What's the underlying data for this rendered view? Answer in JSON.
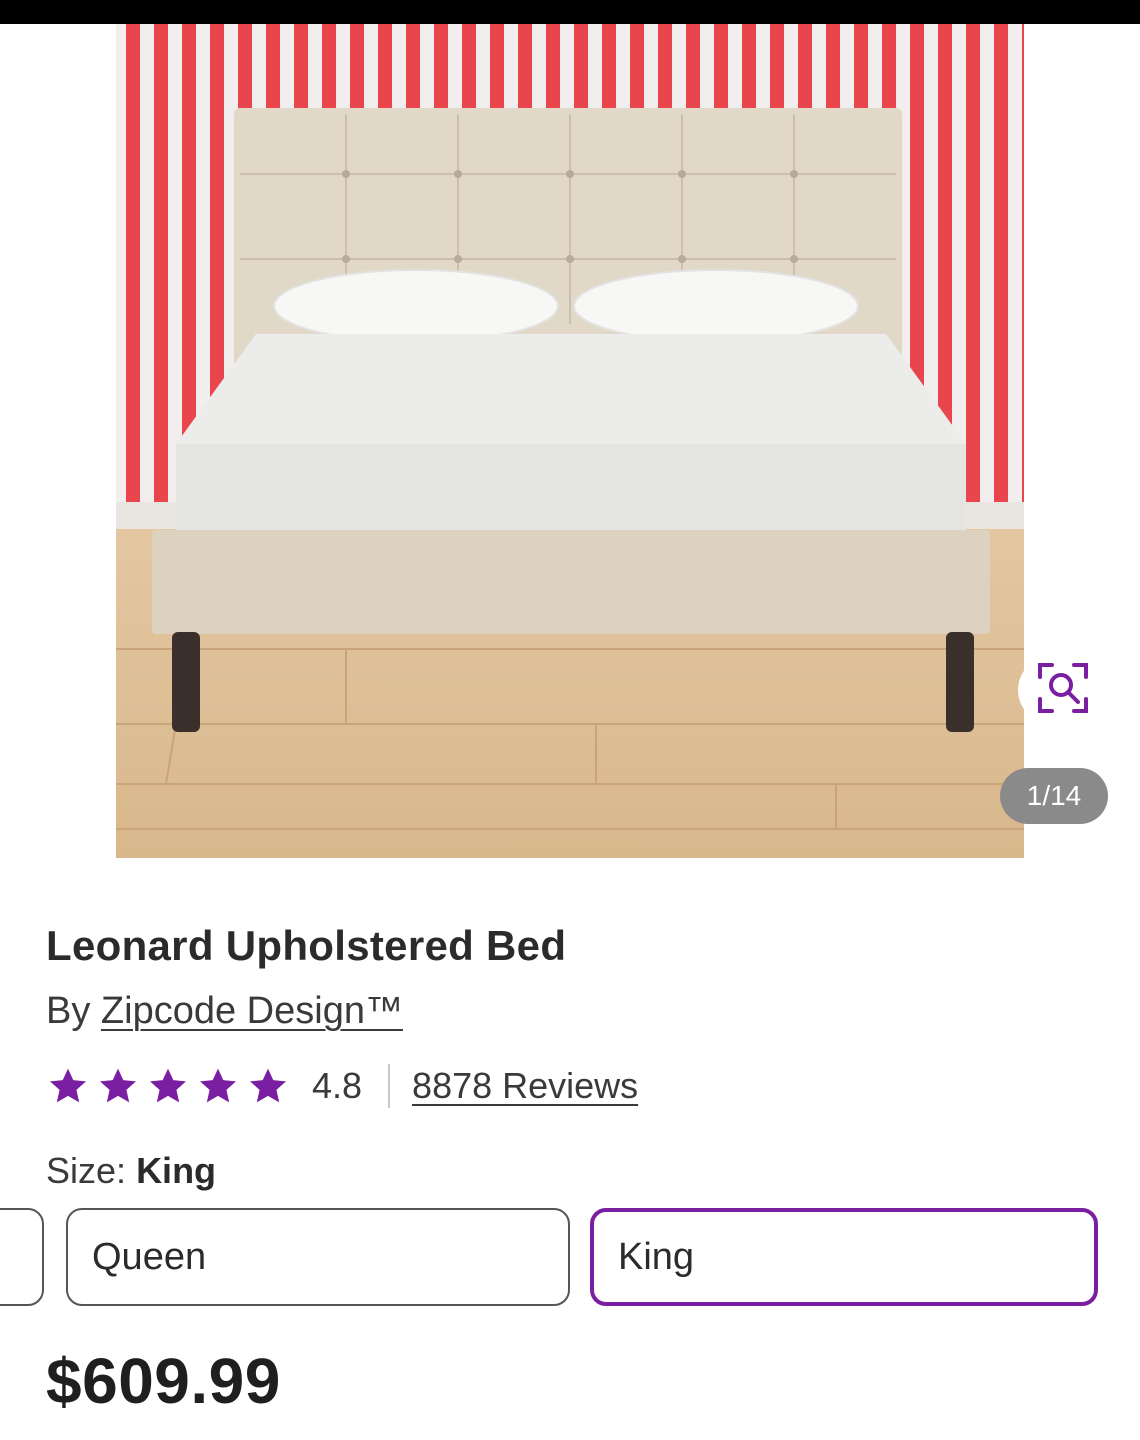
{
  "gallery": {
    "image_description_icon": "bed-product-photo",
    "zoom_icon": "zoom-search-icon",
    "counter": "1/14"
  },
  "product": {
    "title": "Leonard Upholstered Bed",
    "brand_prefix": "By",
    "brand_name": "Zipcode Design™",
    "rating": {
      "stars": 5,
      "value": "4.8",
      "reviews": "8878 Reviews",
      "star_color": "#7b1fa2"
    },
    "size": {
      "label": "Size:",
      "selected": "King",
      "options": [
        "Queen",
        "King"
      ],
      "selected_color": "#7b1fa2"
    },
    "price": "$609.99"
  }
}
